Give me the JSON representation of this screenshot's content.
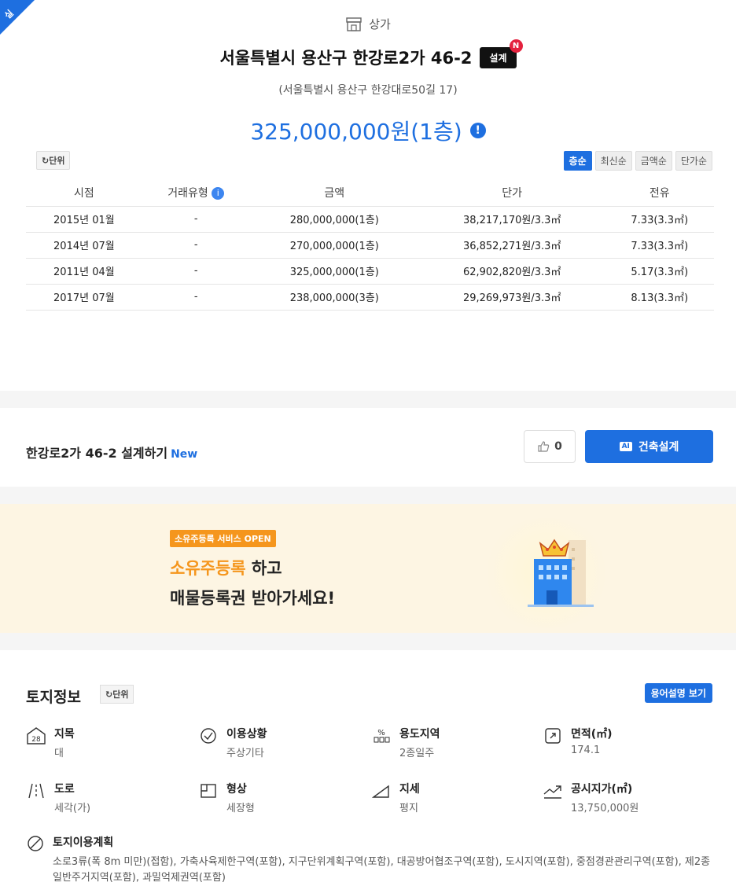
{
  "corner_label": "실",
  "category": "상가",
  "address": "서울특별시 용산구 한강로2가 46-2",
  "badge": "설계",
  "badge_new": "N",
  "road_address": "(서울특별시 용산구 한강대로50길 17)",
  "price": "325,000,000원(1층)",
  "unit_button": "단위",
  "sort_options": [
    "층순",
    "최신순",
    "금액순",
    "단가순"
  ],
  "table": {
    "headers": [
      "시점",
      "거래유형",
      "금액",
      "단가",
      "전유"
    ],
    "rows": [
      [
        "2015년 01월",
        "-",
        "280,000,000(1층)",
        "38,217,170원/3.3㎡",
        "7.33(3.3㎡)"
      ],
      [
        "2014년 07월",
        "-",
        "270,000,000(1층)",
        "36,852,271원/3.3㎡",
        "7.33(3.3㎡)"
      ],
      [
        "2011년 04월",
        "-",
        "325,000,000(1층)",
        "62,902,820원/3.3㎡",
        "5.17(3.3㎡)"
      ],
      [
        "2017년 07월",
        "-",
        "238,000,000(3층)",
        "29,269,973원/3.3㎡",
        "8.13(3.3㎡)"
      ]
    ]
  },
  "design": {
    "title": "한강로2가 46-2 설계하기",
    "new": "New",
    "likes": "0",
    "ai_tag": "AI",
    "ai_button": "건축설계"
  },
  "banner": {
    "tag": "소유주등록 서비스 OPEN",
    "highlight": "소유주등록",
    "line1_rest": " 하고",
    "line2": "매물등록권 받아가세요!"
  },
  "land": {
    "title": "토지정보",
    "unit": "단위",
    "glossary": "용어설명 보기",
    "items": [
      {
        "label": "지목",
        "value": "대",
        "icon": "28"
      },
      {
        "label": "이용상황",
        "value": "주상기타",
        "icon": "check-icon"
      },
      {
        "label": "용도지역",
        "value": "2종일주",
        "icon": "zone-icon"
      },
      {
        "label": "면적(㎡)",
        "value": "174.1",
        "icon": "area-icon"
      },
      {
        "label": "도로",
        "value": "세각(가)",
        "icon": "road-icon"
      },
      {
        "label": "형상",
        "value": "세장형",
        "icon": "shape-icon"
      },
      {
        "label": "지세",
        "value": "평지",
        "icon": "slope-icon"
      },
      {
        "label": "공시지가(㎡)",
        "value": "13,750,000원",
        "icon": "trend-icon"
      }
    ],
    "plan_label": "토지이용계획",
    "plan_value": "소로3류(폭 8m 미만)(접함), 가축사육제한구역(포함), 지구단위계획구역(포함), 대공방어협조구역(포함), 도시지역(포함), 중점경관관리구역(포함), 제2종일반주거지역(포함), 과밀억제권역(포함)"
  }
}
